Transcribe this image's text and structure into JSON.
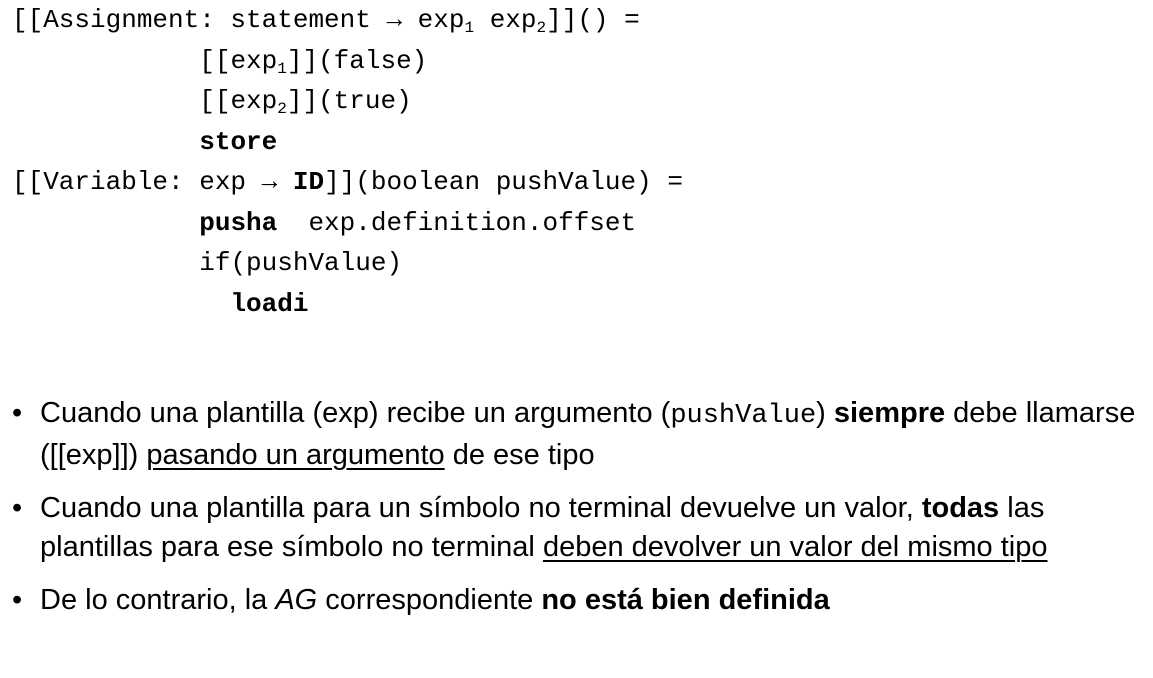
{
  "code": {
    "assignment_head_pre": "[[Assignment: statement → exp",
    "assignment_head_sub1": "1",
    "assignment_head_mid": " exp",
    "assignment_head_sub2": "2",
    "assignment_head_post": "]]() =",
    "line2_pre": "[[exp",
    "line2_sub": "1",
    "line2_post": "]](false)",
    "line3_pre": "[[exp",
    "line3_sub": "2",
    "line3_post": "]](true)",
    "line4_kw": "store",
    "variable_head_pre": "[[Variable: exp → ",
    "variable_head_kw": "ID",
    "variable_head_post": "]](boolean pushValue) =",
    "line6_kw": "pusha",
    "line6_rest": "  exp.definition.offset",
    "line7": "if(pushValue)",
    "line8_kw": "loadi"
  },
  "bullets": {
    "b1": {
      "t1": "Cuando una plantilla (exp) recibe un argumento (",
      "mono": "pushValue",
      "t2": ") ",
      "bold": "siempre",
      "t3": " debe llamarse ([[exp]]) ",
      "underline": "pasando un argumento",
      "t4": " de ese tipo"
    },
    "b2": {
      "t1": "Cuando una plantilla para un símbolo no terminal devuelve un valor, ",
      "bold": "todas",
      "t2": " las plantillas para ese símbolo no terminal ",
      "underline": "deben devolver un valor del mismo tipo"
    },
    "b3": {
      "t1": "De lo contrario, la ",
      "italic": "AG",
      "t2": " correspondiente ",
      "bold": "no está bien definida"
    },
    "marker": "•"
  }
}
